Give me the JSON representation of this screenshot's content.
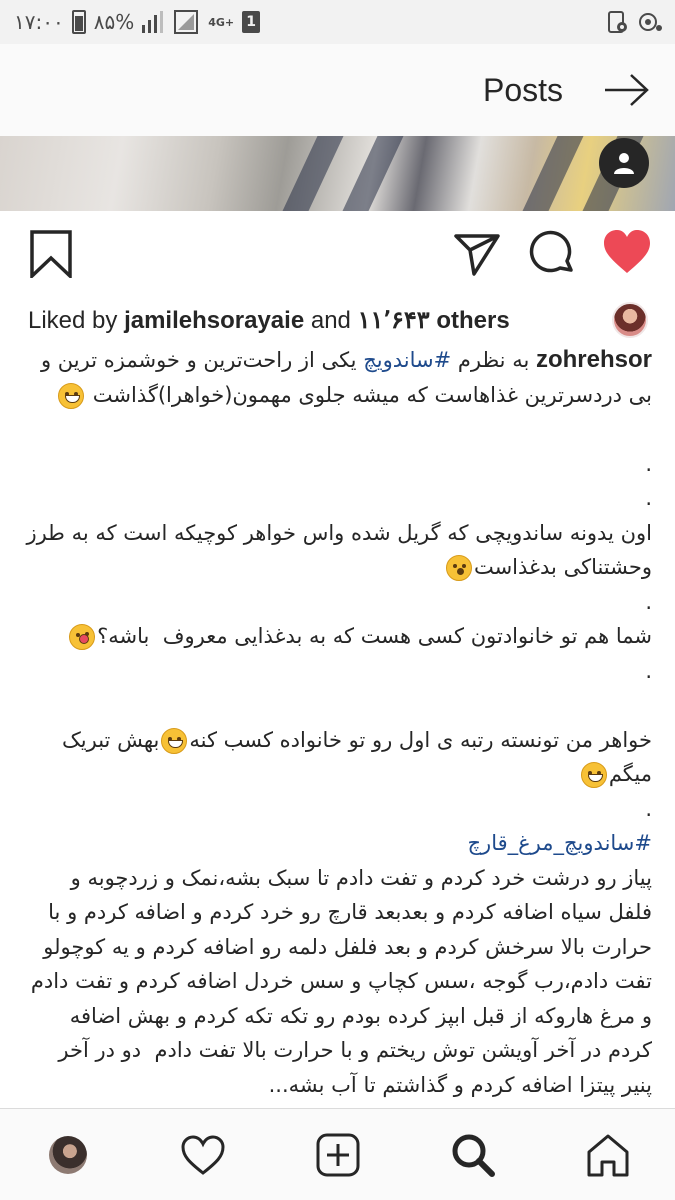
{
  "status_bar": {
    "time": "۱۷:۰۰",
    "battery": "۸۵%",
    "network": "4G+",
    "sim": "1"
  },
  "header": {
    "title": "Posts"
  },
  "likes": {
    "prefix": "Liked by ",
    "user": "jamilehsorayaie",
    "middle": " and ",
    "count": "۱۱٬۶۴۳ others"
  },
  "caption": {
    "username": "zohrehsor",
    "intro_before_tag": " به نظرم ",
    "intro_tag": "#ساندویچ",
    "intro_after_tag": " یکی از راحت‌ترین و خوشمزه ترین و بی دردسرترین غذاهاست که میشه جلوی مهمون(خواهرا)گذاشت",
    "dot": ".",
    "para2": "اون یدونه ساندویچی که گریل شده واس خواهر کوچیکه است که به طرز وحشتناکی بدغذاست",
    "para3": "شما هم تو خانوادتون کسی هست که به بدغذایی معروف  باشه؟",
    "para4_a": "خواهر من تونسته رتبه ی اول رو تو خانواده کسب کنه",
    "para4_b": "بهش تبریک میگم",
    "recipe_tag": "#ساندویچ_مرغ_قارچ",
    "recipe": "پیاز رو درشت خرد کردم و تفت دادم تا سبک بشه،نمک و زردچوبه و فلفل سیاه اضافه کردم و بعدبعد قارچ رو خرد کردم و اضافه کردم و با حرارت بالا سرخش کردم و بعد فلفل دلمه رو اضافه کردم و یه کوچولو تفت دادم،رب گوجه ،سس کچاپ و سس خردل اضافه کردم و تفت دادم و مرغ هاروکه از قبل ابپز کرده بودم رو تکه تکه کردم و بهش اضافه کردم در آخر آویشن توش ریختم و با حرارت بالا تفت دادم  دو در آخر پنیر پیتزا اضافه کردم و گذاشتم تا آب بشه..."
  },
  "icons": {
    "like_color": "#ed4956"
  }
}
